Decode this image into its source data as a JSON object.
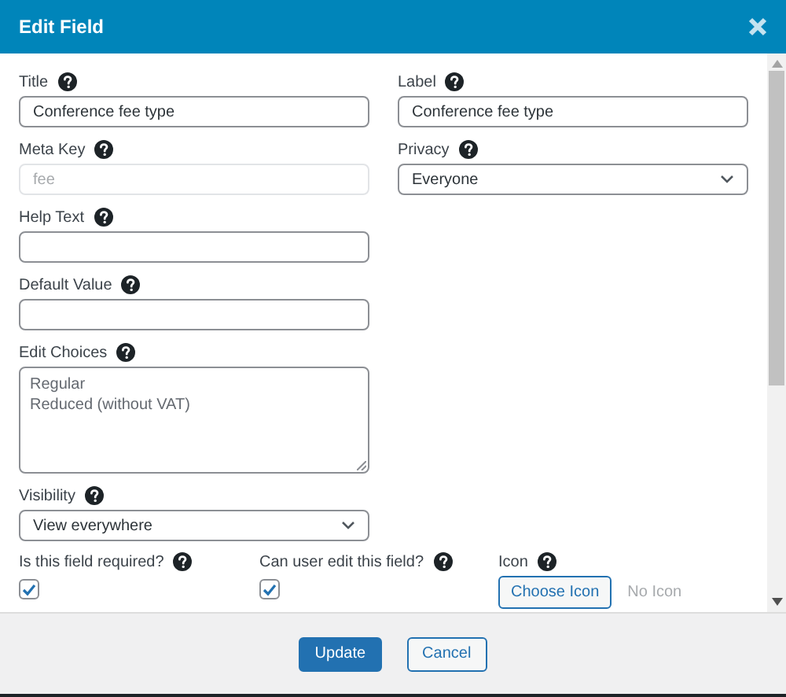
{
  "dialog": {
    "title": "Edit Field"
  },
  "left_fields": [
    {
      "kind": "text",
      "label": "Title",
      "value": "Conference fee type",
      "disabled": false
    },
    {
      "kind": "text",
      "label": "Meta Key",
      "value": "fee",
      "disabled": true
    },
    {
      "kind": "text",
      "label": "Help Text",
      "disabled": false
    },
    {
      "kind": "text",
      "label": "Default Value",
      "disabled": false
    },
    {
      "kind": "textarea",
      "label": "Edit Choices",
      "lines": [
        "Regular",
        "Reduced (without VAT)"
      ]
    },
    {
      "kind": "select",
      "label": "Visibility",
      "value": "View everywhere"
    }
  ],
  "right_fields": [
    {
      "kind": "text",
      "label": "Label",
      "value": "Conference fee type",
      "disabled": false
    },
    {
      "kind": "select",
      "label": "Privacy",
      "value": "Everyone"
    }
  ],
  "options": [
    {
      "kind": "checkbox",
      "label": "Is this field required?",
      "checked": true
    },
    {
      "kind": "checkbox",
      "label": "Can user edit this field?",
      "checked": true
    },
    {
      "kind": "icon",
      "label": "Icon",
      "button": "Choose Icon",
      "note": "No Icon"
    }
  ],
  "buttons": [
    {
      "label": "Update",
      "kind": "primary"
    },
    {
      "label": "Cancel",
      "kind": "secondary"
    }
  ]
}
